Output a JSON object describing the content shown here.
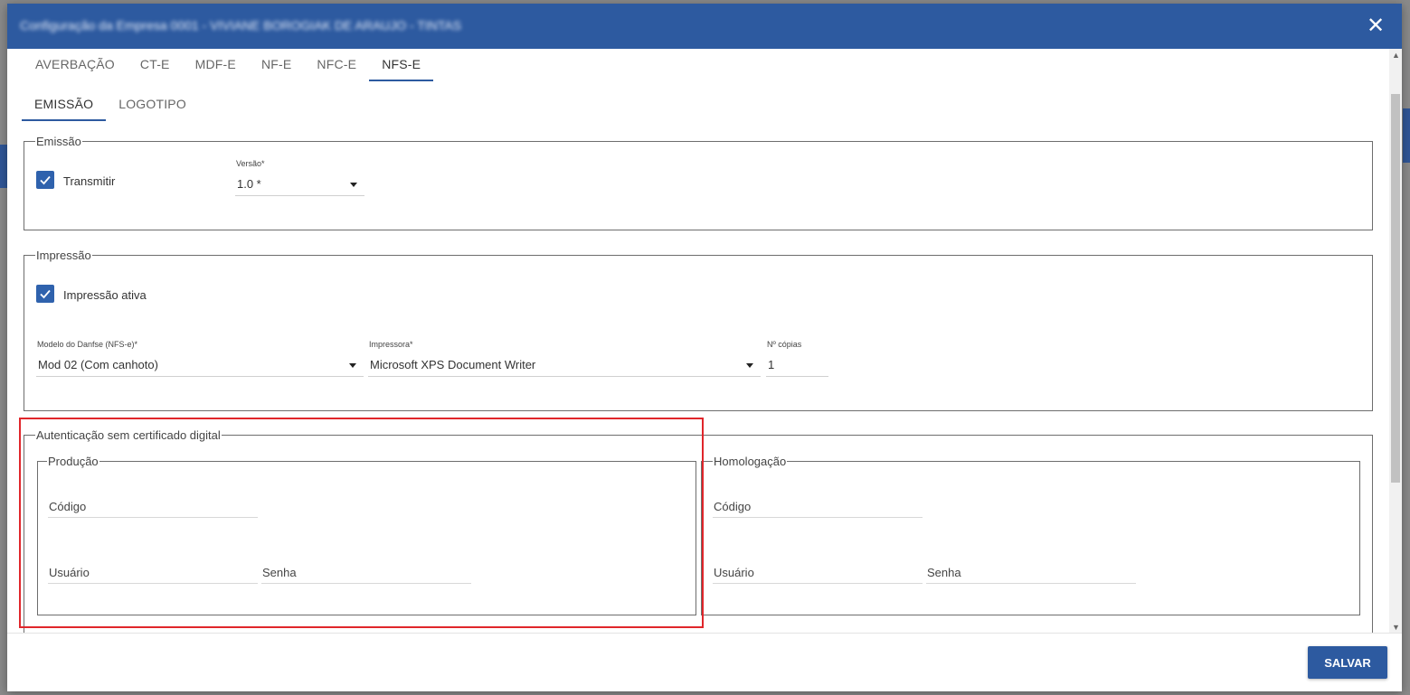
{
  "dialog": {
    "title": "Configuração da Empresa 0001 - VIVIANE BOROGIAK DE ARAUJO - TINTAS"
  },
  "tabs": [
    "AVERBAÇÃO",
    "CT-E",
    "MDF-E",
    "NF-E",
    "NFC-E",
    "NFS-E"
  ],
  "active_tab": "NFS-E",
  "subtabs": [
    "EMISSÃO",
    "LOGOTIPO"
  ],
  "active_subtab": "EMISSÃO",
  "emissao": {
    "legend": "Emissão",
    "transmitir_label": "Transmitir",
    "versao_label": "Versão*",
    "versao_value": "1.0 *"
  },
  "impressao": {
    "legend": "Impressão",
    "ativa_label": "Impressão ativa",
    "modelo_label": "Modelo do Danfse (NFS-e)*",
    "modelo_value": "Mod 02 (Com canhoto)",
    "impressora_label": "Impressora*",
    "impressora_value": "Microsoft XPS Document Writer",
    "copias_label": "Nº cópias",
    "copias_value": "1"
  },
  "autenticacao": {
    "legend": "Autenticação sem certificado digital",
    "producao": {
      "legend": "Produção",
      "codigo": "Código",
      "usuario": "Usuário",
      "senha": "Senha"
    },
    "homologacao": {
      "legend": "Homologação",
      "codigo": "Código",
      "usuario": "Usuário",
      "senha": "Senha"
    }
  },
  "footer": {
    "save_label": "SALVAR"
  },
  "colors": {
    "primary": "#2d5aa0",
    "highlight": "#e0262b",
    "checkbox": "#2f62ad"
  }
}
